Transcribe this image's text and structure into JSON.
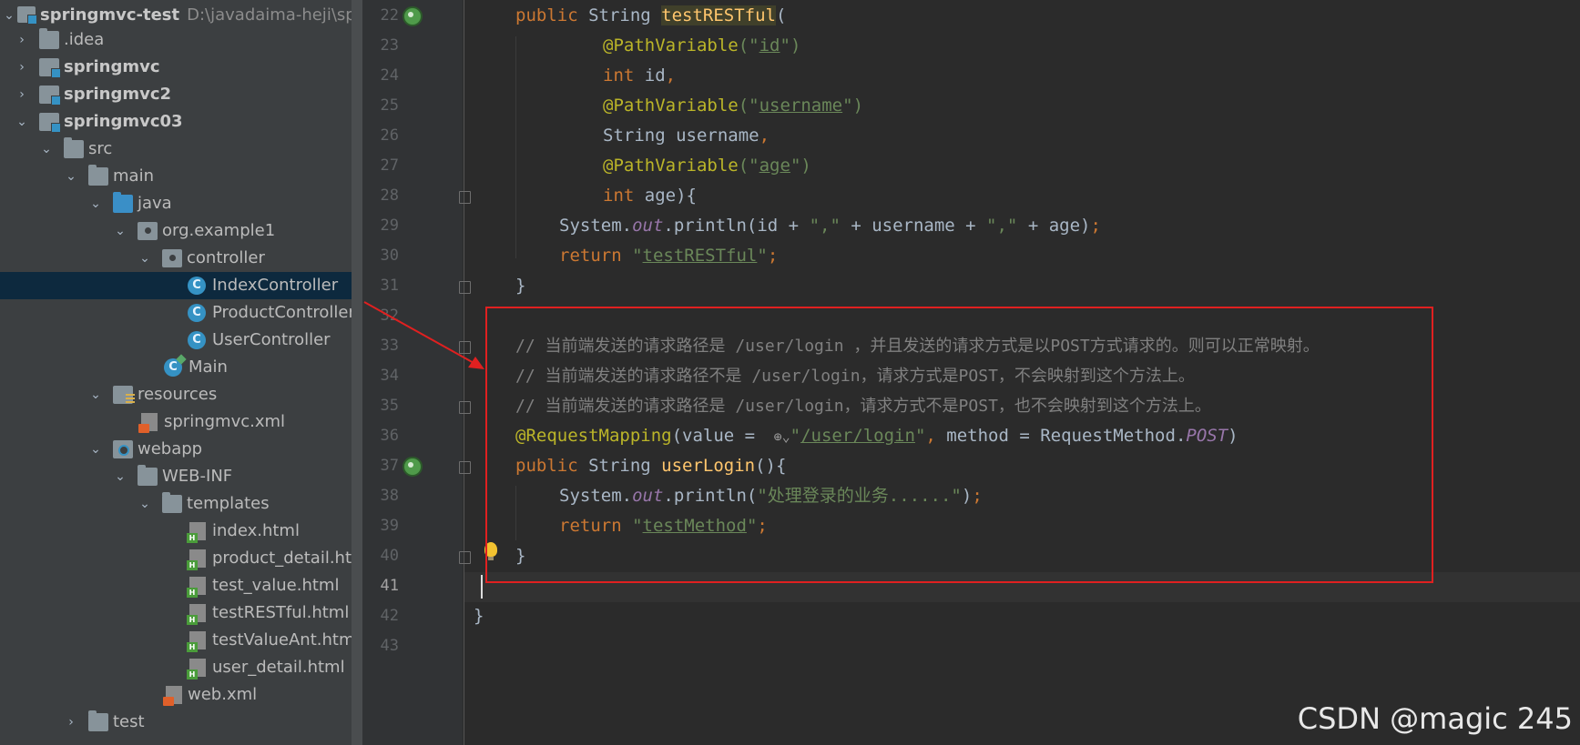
{
  "project_tree": {
    "items": [
      {
        "label": "springmvc-test",
        "path": "D:\\javadaima-heji\\spring",
        "icon": "module-icon",
        "expanded": true
      },
      {
        "label": ".idea",
        "icon": "folder-icon",
        "expanded": false
      },
      {
        "label": "springmvc",
        "icon": "module-icon",
        "expanded": false
      },
      {
        "label": "springmvc2",
        "icon": "module-icon",
        "expanded": false
      },
      {
        "label": "springmvc03",
        "icon": "module-icon",
        "expanded": true
      },
      {
        "label": "src",
        "icon": "folder-icon",
        "expanded": true
      },
      {
        "label": "main",
        "icon": "folder-icon",
        "expanded": true
      },
      {
        "label": "java",
        "icon": "source-folder-icon",
        "expanded": true
      },
      {
        "label": "org.example1",
        "icon": "package-icon",
        "expanded": true
      },
      {
        "label": "controller",
        "icon": "package-icon",
        "expanded": true
      },
      {
        "label": "IndexController",
        "icon": "class-icon",
        "selected": true
      },
      {
        "label": "ProductController",
        "icon": "class-icon"
      },
      {
        "label": "UserController",
        "icon": "class-icon"
      },
      {
        "label": "Main",
        "icon": "main-class-icon"
      },
      {
        "label": "resources",
        "icon": "resources-folder-icon",
        "expanded": true
      },
      {
        "label": "springmvc.xml",
        "icon": "xml-file-icon"
      },
      {
        "label": "webapp",
        "icon": "web-folder-icon",
        "expanded": true
      },
      {
        "label": "WEB-INF",
        "icon": "folder-icon",
        "expanded": true
      },
      {
        "label": "templates",
        "icon": "folder-icon",
        "expanded": true
      },
      {
        "label": "index.html",
        "icon": "html-file-icon"
      },
      {
        "label": "product_detail.html",
        "icon": "html-file-icon"
      },
      {
        "label": "test_value.html",
        "icon": "html-file-icon"
      },
      {
        "label": "testRESTful.html",
        "icon": "html-file-icon"
      },
      {
        "label": "testValueAnt.html",
        "icon": "html-file-icon"
      },
      {
        "label": "user_detail.html",
        "icon": "html-file-icon"
      },
      {
        "label": "web.xml",
        "icon": "xml-file-icon"
      },
      {
        "label": "test",
        "icon": "folder-icon",
        "expanded": false
      }
    ]
  },
  "editor": {
    "line_numbers": [
      "22",
      "23",
      "24",
      "25",
      "26",
      "27",
      "28",
      "29",
      "30",
      "31",
      "32",
      "33",
      "34",
      "35",
      "36",
      "37",
      "38",
      "39",
      "40",
      "41",
      "42",
      "43"
    ],
    "current_line": "41",
    "code": {
      "l22": {
        "kw": "public",
        "type": " String ",
        "fn": "testRESTful",
        "rest": "("
      },
      "l23": {
        "an": "@PathVariable",
        "p1": "(\"",
        "s": "id",
        "p2": "\")"
      },
      "l24": {
        "kw": "int",
        "rest": " id",
        "comma": ","
      },
      "l25": {
        "an": "@PathVariable",
        "p1": "(\"",
        "s": "username",
        "p2": "\")"
      },
      "l26": {
        "rest": "String username",
        "comma": ","
      },
      "l27": {
        "an": "@PathVariable",
        "p1": "(\"",
        "s": "age",
        "p2": "\")"
      },
      "l28": {
        "kw": "int",
        "rest": " age){"
      },
      "l29": {
        "a": "System.",
        "field": "out",
        "b": ".println(id + ",
        "s1": "\",\"",
        "c": " + username + ",
        "s2": "\",\"",
        "d": " + age)",
        "semi": ";"
      },
      "l30": {
        "kw": "return",
        "sp": " ",
        "q1": "\"",
        "s": "testRESTful",
        "q2": "\"",
        "semi": ";"
      },
      "l31": {
        "rest": "}"
      },
      "l33": {
        "comment": "// 当前端发送的请求路径是 /user/login ，并且发送的请求方式是以POST方式请求的。则可以正常映射。"
      },
      "l34": {
        "comment": "// 当前端发送的请求路径不是 /user/login，请求方式是POST，不会映射到这个方法上。"
      },
      "l35": {
        "comment": "// 当前端发送的请求路径是 /user/login，请求方式不是POST，也不会映射到这个方法上。"
      },
      "l36": {
        "an": "@RequestMapping",
        "a": "(value = ",
        "q1": "\"",
        "url": "/user/login",
        "q2": "\"",
        "comma": ",",
        "b": " method = RequestMethod.",
        "field": "POST",
        "c": ")"
      },
      "l37": {
        "kw": "public",
        "type": " String ",
        "fn": "userLogin",
        "rest": "(){"
      },
      "l38": {
        "a": "System.",
        "field": "out",
        "b": ".println(",
        "s": "\"处理登录的业务......\"",
        "c": ")",
        "semi": ";"
      },
      "l39": {
        "kw": "return",
        "sp": " ",
        "q1": "\"",
        "s": "testMethod",
        "q2": "\"",
        "semi": ";"
      },
      "l40": {
        "rest": "}"
      },
      "l42": {
        "rest": "}"
      }
    }
  },
  "watermark": "CSDN @magic 245",
  "colors": {
    "annotation_box": "#e02020",
    "keyword": "#cc7832",
    "string": "#6a8759",
    "comment": "#808080"
  }
}
